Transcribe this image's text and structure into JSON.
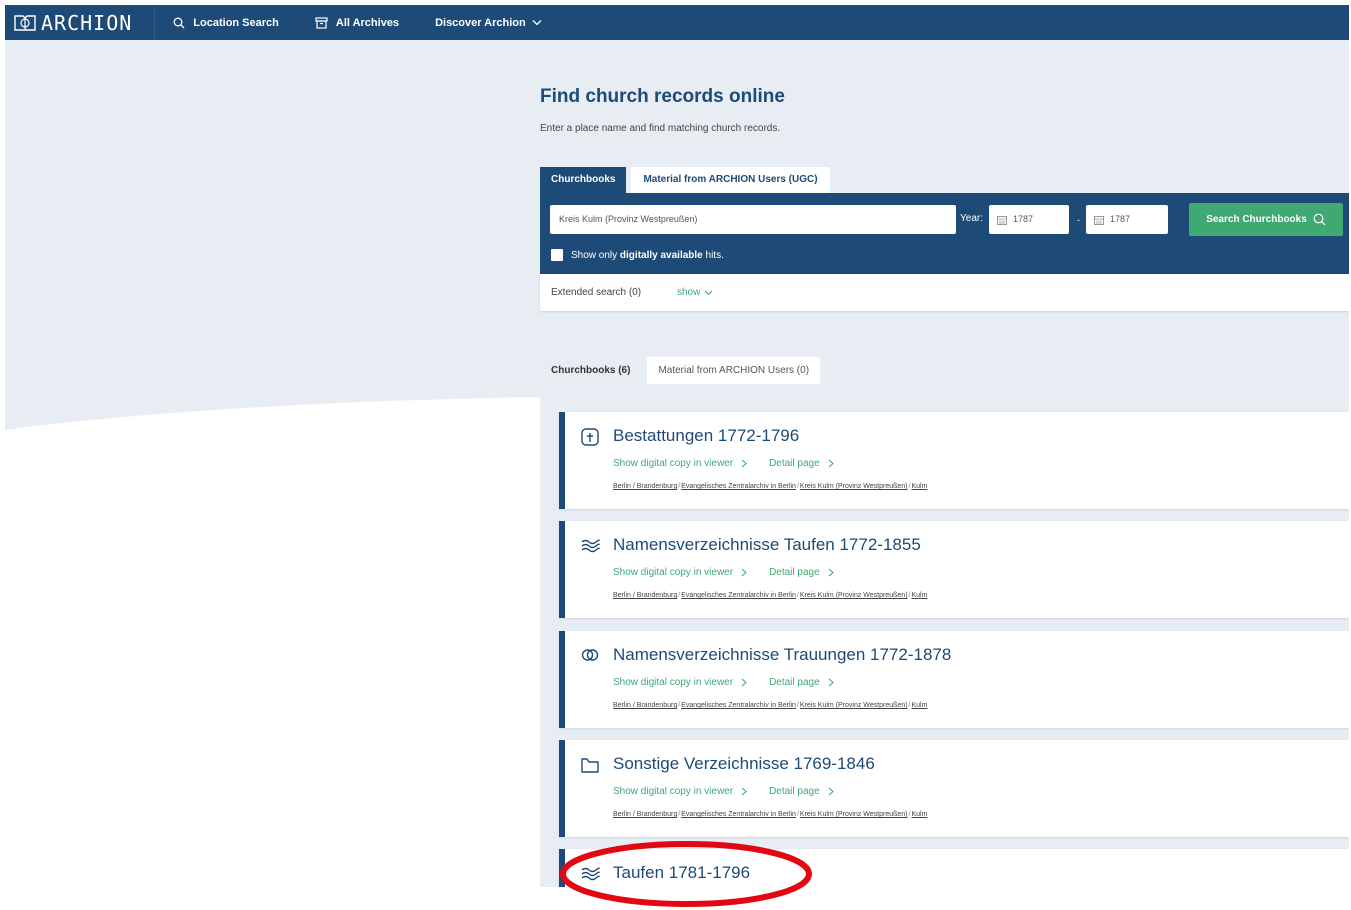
{
  "nav": {
    "logo_text": "ARCHION",
    "items": [
      {
        "label": "Location Search",
        "icon": "search-icon"
      },
      {
        "label": "All Archives",
        "icon": "archive-box-icon"
      },
      {
        "label": "Discover Archion",
        "icon": "chevron-down-icon"
      }
    ]
  },
  "main": {
    "title": "Find church records online",
    "subtitle": "Enter a place name and find matching church records.",
    "tabs": [
      {
        "label": "Churchbooks",
        "active": true
      },
      {
        "label": "Material from ARCHION Users (UGC)",
        "active": false
      }
    ],
    "search": {
      "place_value": "Kreis Kulm (Provinz Westpreußen)",
      "year_label": "Year:",
      "year_from": "1787",
      "year_sep": "-",
      "year_to": "1787",
      "button_label": "Search Churchbooks",
      "checkbox_prefix": "Show only ",
      "checkbox_bold": "digitally available",
      "checkbox_suffix": " hits."
    },
    "extended": {
      "label": "Extended search (0)",
      "toggle": "show"
    },
    "result_tabs": [
      {
        "label": "Churchbooks (6)",
        "active": true
      },
      {
        "label": "Material from ARCHION Users (0)",
        "active": false
      }
    ]
  },
  "results": [
    {
      "title": "Bestattungen 1772-1796",
      "icon": "cross-box-icon",
      "viewer_link": "Show digital copy in viewer",
      "detail_link": "Detail page",
      "path": [
        "Berlin / Brandenburg",
        "Evangelisches Zentralarchiv in Berlin",
        "Kreis Kulm (Provinz Westpreußen)",
        "Kulm"
      ]
    },
    {
      "title": "Namensverzeichnisse Taufen 1772-1855",
      "icon": "water-waves-icon",
      "viewer_link": "Show digital copy in viewer",
      "detail_link": "Detail page",
      "path": [
        "Berlin / Brandenburg",
        "Evangelisches Zentralarchiv in Berlin",
        "Kreis Kulm (Provinz Westpreußen)",
        "Kulm"
      ]
    },
    {
      "title": "Namensverzeichnisse Trauungen 1772-1878",
      "icon": "rings-icon",
      "viewer_link": "Show digital copy in viewer",
      "detail_link": "Detail page",
      "path": [
        "Berlin / Brandenburg",
        "Evangelisches Zentralarchiv in Berlin",
        "Kreis Kulm (Provinz Westpreußen)",
        "Kulm"
      ]
    },
    {
      "title": "Sonstige Verzeichnisse 1769-1846",
      "icon": "folder-icon",
      "viewer_link": "Show digital copy in viewer",
      "detail_link": "Detail page",
      "path": [
        "Berlin / Brandenburg",
        "Evangelisches Zentralarchiv in Berlin",
        "Kreis Kulm (Provinz Westpreußen)",
        "Kulm"
      ]
    },
    {
      "title": "Taufen 1781-1796",
      "icon": "water-waves-icon"
    }
  ],
  "colors": {
    "nav_bg": "#1e4a77",
    "accent_green": "#3fa873",
    "page_bg": "#e8edf3",
    "annotation_red": "#e30613"
  }
}
